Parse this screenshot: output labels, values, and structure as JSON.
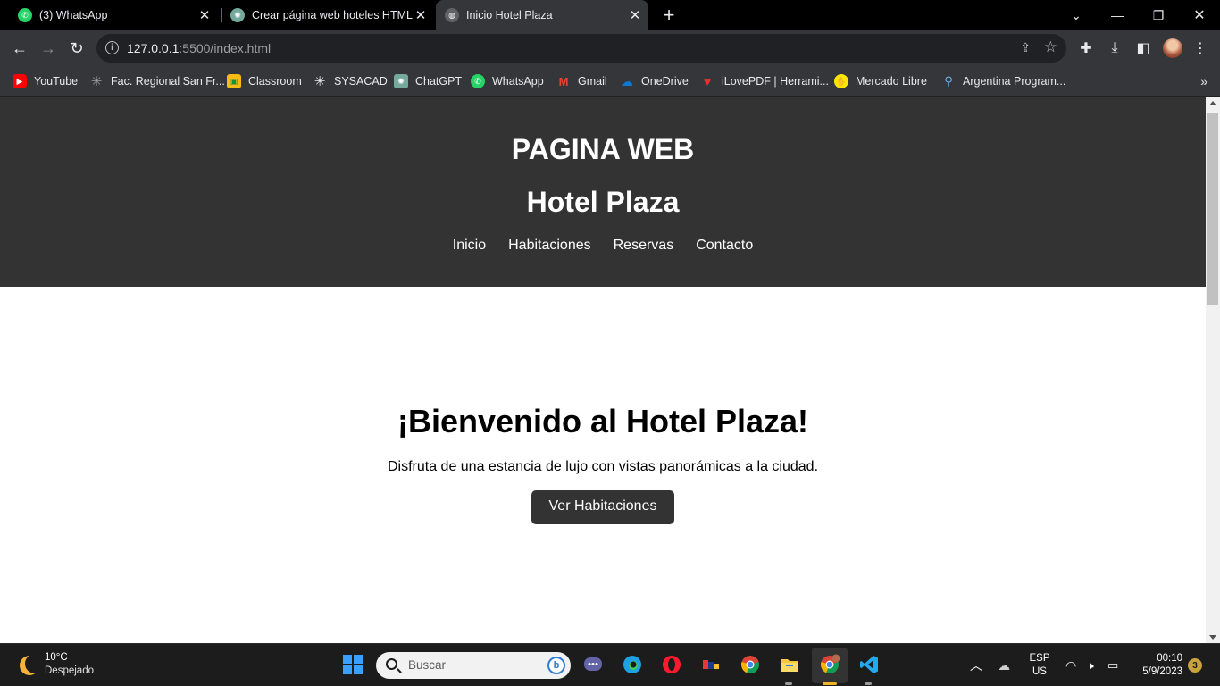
{
  "browser": {
    "tabs": [
      {
        "title": "(3) WhatsApp",
        "icon": "whatsapp-icon"
      },
      {
        "title": "Crear página web hoteles HTML/",
        "icon": "chatgpt-icon"
      },
      {
        "title": "Inicio Hotel Plaza",
        "icon": "globe-icon"
      }
    ],
    "address": {
      "host": "127.0.0.1",
      "rest": ":5500/index.html"
    },
    "bookmarks": [
      {
        "label": "YouTube",
        "icon": "youtube-icon",
        "color": "#ff0000"
      },
      {
        "label": "Fac. Regional San Fr...",
        "icon": "utn-icon",
        "color": "#1c1c1c"
      },
      {
        "label": "Classroom",
        "icon": "classroom-icon",
        "color": "#f9bc15"
      },
      {
        "label": "SYSACAD",
        "icon": "sysacad-icon",
        "color": "#1c1c1c"
      },
      {
        "label": "ChatGPT",
        "icon": "chatgpt-icon",
        "color": "#74aa9c"
      },
      {
        "label": "WhatsApp",
        "icon": "whatsapp-icon",
        "color": "#25d366"
      },
      {
        "label": "Gmail",
        "icon": "gmail-icon",
        "color": "#ea4335"
      },
      {
        "label": "OneDrive",
        "icon": "onedrive-icon",
        "color": "#0f78d4"
      },
      {
        "label": "iLovePDF | Herrami...",
        "icon": "ilovepdf-icon",
        "color": "#e5322d"
      },
      {
        "label": "Mercado Libre",
        "icon": "mercadolibre-icon",
        "color": "#ffe600"
      },
      {
        "label": "Argentina Program...",
        "icon": "argentina-icon",
        "color": "#6ab0de"
      }
    ]
  },
  "site": {
    "header_title": "PAGINA WEB",
    "hotel_name": "Hotel Plaza",
    "nav": [
      "Inicio",
      "Habitaciones",
      "Reservas",
      "Contacto"
    ],
    "hero": {
      "heading": "¡Bienvenido al Hotel Plaza!",
      "text": "Disfruta de una estancia de lujo con vistas panorámicas a la ciudad.",
      "button": "Ver Habitaciones"
    }
  },
  "taskbar": {
    "weather": {
      "temp": "10°C",
      "desc": "Despejado"
    },
    "search_placeholder": "Buscar",
    "lang": {
      "line1": "ESP",
      "line2": "US"
    },
    "clock": {
      "time": "00:10",
      "date": "5/9/2023"
    },
    "notifications": "3"
  },
  "colors": {
    "header_bg": "#333333",
    "accent_blue": "#3aa0ff"
  }
}
